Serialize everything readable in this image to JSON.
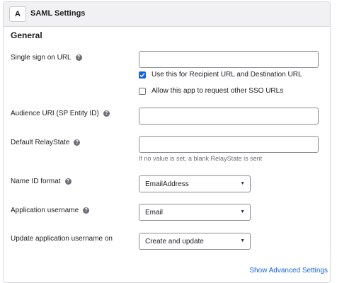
{
  "header": {
    "step": "A",
    "title": "SAML Settings"
  },
  "section": {
    "title": "General"
  },
  "fields": {
    "sso_url": {
      "label": "Single sign on URL",
      "value": ""
    },
    "recipient_checkbox": {
      "label": "Use this for Recipient URL and Destination URL",
      "checked": true
    },
    "other_sso_checkbox": {
      "label": "Allow this app to request other SSO URLs",
      "checked": false
    },
    "audience_uri": {
      "label": "Audience URI (SP Entity ID)",
      "value": ""
    },
    "relay_state": {
      "label": "Default RelayState",
      "value": "",
      "hint": "If no value is set, a blank RelayState is sent"
    },
    "name_id_format": {
      "label": "Name ID format",
      "value": "EmailAddress"
    },
    "app_username": {
      "label": "Application username",
      "value": "Email"
    },
    "update_username": {
      "label": "Update application username on",
      "value": "Create and update"
    }
  },
  "footer": {
    "advanced_link": "Show Advanced Settings"
  },
  "icons": {
    "help": "help-circle-icon",
    "dropdown": "caret-down-icon",
    "check": "checkmark-icon"
  },
  "colors": {
    "accent": "#1662dd",
    "header_bg": "#f1f1f3",
    "border": "#d7d7dc"
  }
}
